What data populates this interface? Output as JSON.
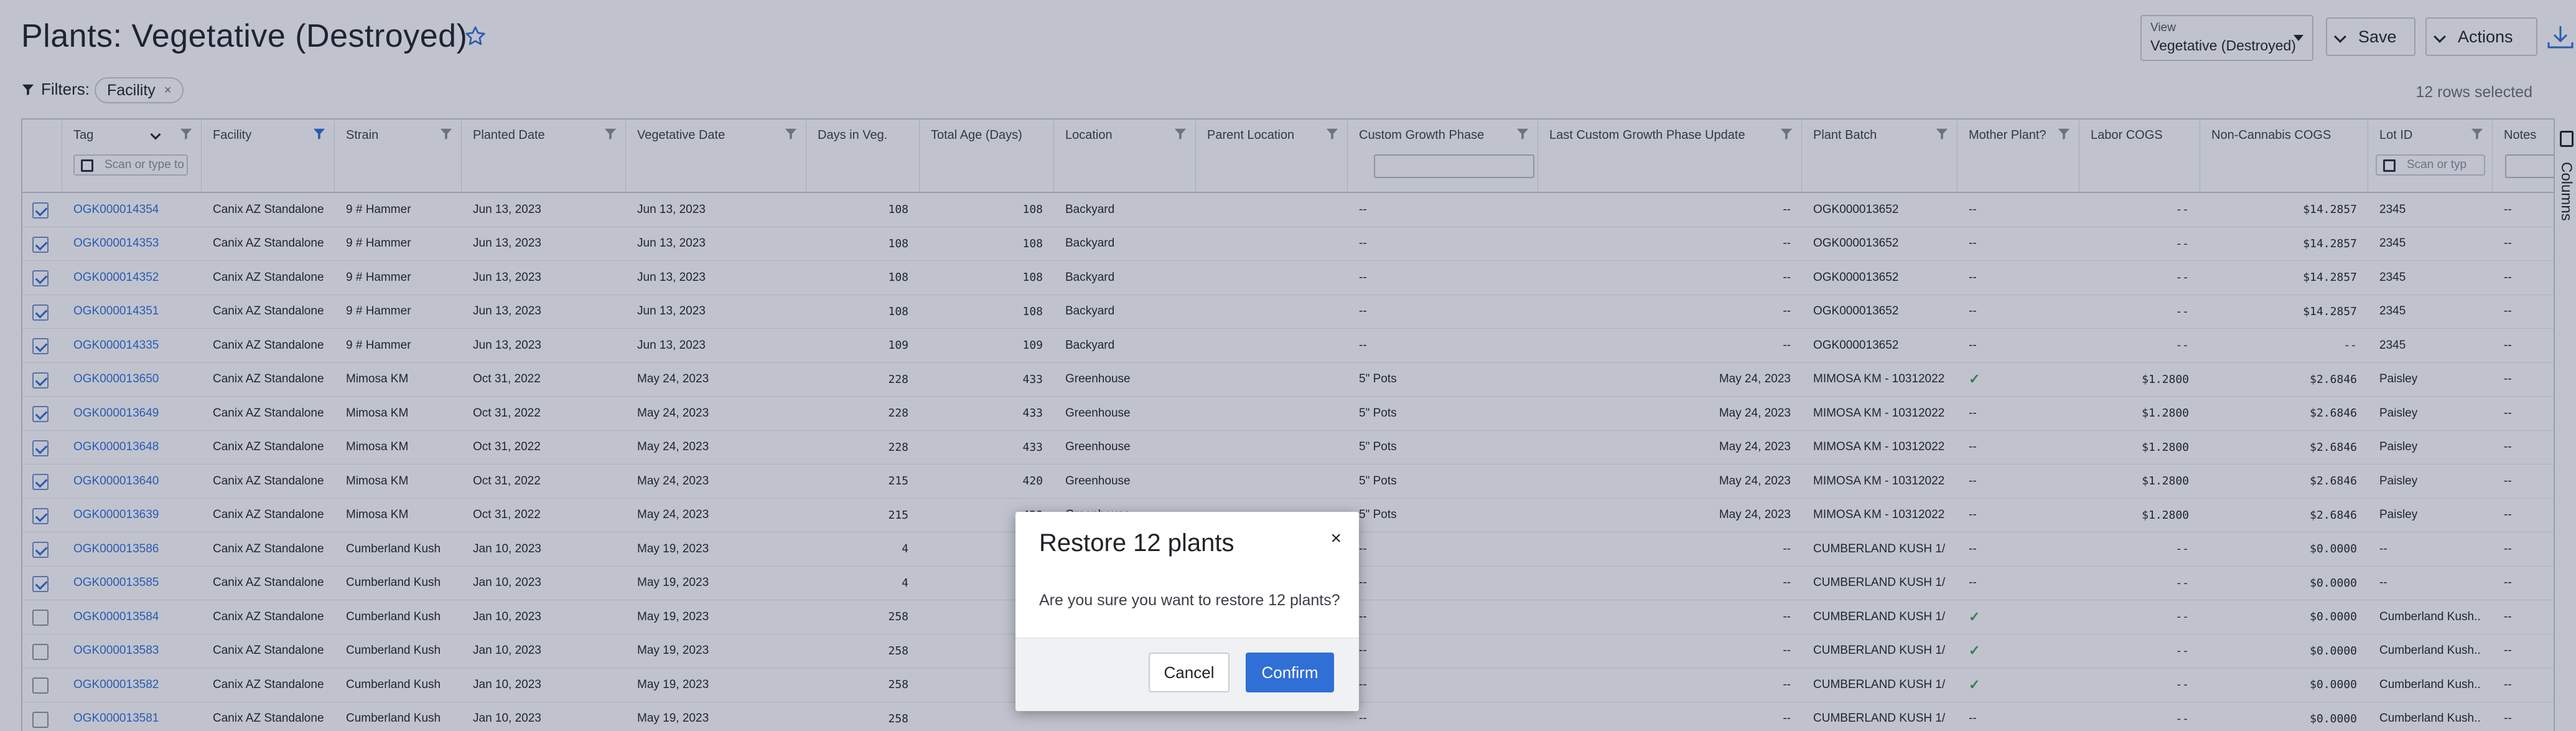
{
  "page": {
    "title": "Plants: Vegetative (Destroyed)"
  },
  "toolbar": {
    "view_label": "View",
    "view_value": "Vegetative (Destroyed)",
    "save_label": "Save",
    "actions_label": "Actions"
  },
  "filters": {
    "label": "Filters:",
    "chips": [
      {
        "label": "Facility"
      }
    ],
    "rows_selected": "12 rows selected"
  },
  "grid": {
    "columns": [
      "Tag",
      "Facility",
      "Strain",
      "Planted Date",
      "Vegetative Date",
      "Days in Veg.",
      "Total Age (Days)",
      "Location",
      "Parent Location",
      "Custom Growth Phase",
      "Last Custom Growth Phase Update",
      "Plant Batch",
      "Mother Plant?",
      "Labor COGS",
      "Non-Cannabis COGS",
      "Lot ID",
      "Notes"
    ],
    "scan_placeholder": "Scan or type to",
    "scan_placeholder_lot": "Scan or typ",
    "side_panel_label": "Columns",
    "rows": [
      {
        "checked": true,
        "tag": "OGK000014354",
        "facility": "Canix AZ Standalone",
        "strain": "9 # Hammer",
        "planted": "Jun 13, 2023",
        "veg_date": "Jun 13, 2023",
        "days_veg": "108",
        "total_age": "108",
        "location": "Backyard",
        "parent_loc": "",
        "cgp": "--",
        "last_cgp": "--",
        "batch": "OGK000013652",
        "mother": "--",
        "labor": "--",
        "noncann": "$14.2857",
        "lot": "2345",
        "notes": "--"
      },
      {
        "checked": true,
        "tag": "OGK000014353",
        "facility": "Canix AZ Standalone",
        "strain": "9 # Hammer",
        "planted": "Jun 13, 2023",
        "veg_date": "Jun 13, 2023",
        "days_veg": "108",
        "total_age": "108",
        "location": "Backyard",
        "parent_loc": "",
        "cgp": "--",
        "last_cgp": "--",
        "batch": "OGK000013652",
        "mother": "--",
        "labor": "--",
        "noncann": "$14.2857",
        "lot": "2345",
        "notes": "--"
      },
      {
        "checked": true,
        "tag": "OGK000014352",
        "facility": "Canix AZ Standalone",
        "strain": "9 # Hammer",
        "planted": "Jun 13, 2023",
        "veg_date": "Jun 13, 2023",
        "days_veg": "108",
        "total_age": "108",
        "location": "Backyard",
        "parent_loc": "",
        "cgp": "--",
        "last_cgp": "--",
        "batch": "OGK000013652",
        "mother": "--",
        "labor": "--",
        "noncann": "$14.2857",
        "lot": "2345",
        "notes": "--"
      },
      {
        "checked": true,
        "tag": "OGK000014351",
        "facility": "Canix AZ Standalone",
        "strain": "9 # Hammer",
        "planted": "Jun 13, 2023",
        "veg_date": "Jun 13, 2023",
        "days_veg": "108",
        "total_age": "108",
        "location": "Backyard",
        "parent_loc": "",
        "cgp": "--",
        "last_cgp": "--",
        "batch": "OGK000013652",
        "mother": "--",
        "labor": "--",
        "noncann": "$14.2857",
        "lot": "2345",
        "notes": "--"
      },
      {
        "checked": true,
        "tag": "OGK000014335",
        "facility": "Canix AZ Standalone",
        "strain": "9 # Hammer",
        "planted": "Jun 13, 2023",
        "veg_date": "Jun 13, 2023",
        "days_veg": "109",
        "total_age": "109",
        "location": "Backyard",
        "parent_loc": "",
        "cgp": "--",
        "last_cgp": "--",
        "batch": "OGK000013652",
        "mother": "--",
        "labor": "--",
        "noncann": "--",
        "lot": "2345",
        "notes": "--"
      },
      {
        "checked": true,
        "tag": "OGK000013650",
        "facility": "Canix AZ Standalone",
        "strain": "Mimosa KM",
        "planted": "Oct 31, 2022",
        "veg_date": "May 24, 2023",
        "days_veg": "228",
        "total_age": "433",
        "location": "Greenhouse",
        "parent_loc": "",
        "cgp": "5\" Pots",
        "last_cgp": "May 24, 2023",
        "batch": "MIMOSA KM - 10312022",
        "mother": "✓",
        "labor": "$1.2800",
        "noncann": "$2.6846",
        "lot": "Paisley",
        "notes": "--"
      },
      {
        "checked": true,
        "tag": "OGK000013649",
        "facility": "Canix AZ Standalone",
        "strain": "Mimosa KM",
        "planted": "Oct 31, 2022",
        "veg_date": "May 24, 2023",
        "days_veg": "228",
        "total_age": "433",
        "location": "Greenhouse",
        "parent_loc": "",
        "cgp": "5\" Pots",
        "last_cgp": "May 24, 2023",
        "batch": "MIMOSA KM - 10312022",
        "mother": "--",
        "labor": "$1.2800",
        "noncann": "$2.6846",
        "lot": "Paisley",
        "notes": "--"
      },
      {
        "checked": true,
        "tag": "OGK000013648",
        "facility": "Canix AZ Standalone",
        "strain": "Mimosa KM",
        "planted": "Oct 31, 2022",
        "veg_date": "May 24, 2023",
        "days_veg": "228",
        "total_age": "433",
        "location": "Greenhouse",
        "parent_loc": "",
        "cgp": "5\" Pots",
        "last_cgp": "May 24, 2023",
        "batch": "MIMOSA KM - 10312022",
        "mother": "--",
        "labor": "$1.2800",
        "noncann": "$2.6846",
        "lot": "Paisley",
        "notes": "--"
      },
      {
        "checked": true,
        "tag": "OGK000013640",
        "facility": "Canix AZ Standalone",
        "strain": "Mimosa KM",
        "planted": "Oct 31, 2022",
        "veg_date": "May 24, 2023",
        "days_veg": "215",
        "total_age": "420",
        "location": "Greenhouse",
        "parent_loc": "",
        "cgp": "5\" Pots",
        "last_cgp": "May 24, 2023",
        "batch": "MIMOSA KM - 10312022",
        "mother": "--",
        "labor": "$1.2800",
        "noncann": "$2.6846",
        "lot": "Paisley",
        "notes": "--"
      },
      {
        "checked": true,
        "tag": "OGK000013639",
        "facility": "Canix AZ Standalone",
        "strain": "Mimosa KM",
        "planted": "Oct 31, 2022",
        "veg_date": "May 24, 2023",
        "days_veg": "215",
        "total_age": "420",
        "location": "Greenhouse",
        "parent_loc": "",
        "cgp": "5\" Pots",
        "last_cgp": "May 24, 2023",
        "batch": "MIMOSA KM - 10312022",
        "mother": "--",
        "labor": "$1.2800",
        "noncann": "$2.6846",
        "lot": "Paisley",
        "notes": "--"
      },
      {
        "checked": true,
        "tag": "OGK000013586",
        "facility": "Canix AZ Standalone",
        "strain": "Cumberland Kush",
        "planted": "Jan 10, 2023",
        "veg_date": "May 19, 2023",
        "days_veg": "4",
        "total_age": "",
        "location": "",
        "parent_loc": "",
        "cgp": "--",
        "last_cgp": "--",
        "batch": "CUMBERLAND KUSH 1/...",
        "mother": "--",
        "labor": "--",
        "noncann": "$0.0000",
        "lot": "--",
        "notes": "--"
      },
      {
        "checked": true,
        "tag": "OGK000013585",
        "facility": "Canix AZ Standalone",
        "strain": "Cumberland Kush",
        "planted": "Jan 10, 2023",
        "veg_date": "May 19, 2023",
        "days_veg": "4",
        "total_age": "",
        "location": "",
        "parent_loc": "",
        "cgp": "--",
        "last_cgp": "--",
        "batch": "CUMBERLAND KUSH 1/...",
        "mother": "--",
        "labor": "--",
        "noncann": "$0.0000",
        "lot": "--",
        "notes": "--"
      },
      {
        "checked": false,
        "tag": "OGK000013584",
        "facility": "Canix AZ Standalone",
        "strain": "Cumberland Kush",
        "planted": "Jan 10, 2023",
        "veg_date": "May 19, 2023",
        "days_veg": "258",
        "total_age": "",
        "location": "",
        "parent_loc": "",
        "cgp": "--",
        "last_cgp": "--",
        "batch": "CUMBERLAND KUSH 1/...",
        "mother": "✓",
        "labor": "--",
        "noncann": "$0.0000",
        "lot": "Cumberland Kush...",
        "notes": "--"
      },
      {
        "checked": false,
        "tag": "OGK000013583",
        "facility": "Canix AZ Standalone",
        "strain": "Cumberland Kush",
        "planted": "Jan 10, 2023",
        "veg_date": "May 19, 2023",
        "days_veg": "258",
        "total_age": "",
        "location": "",
        "parent_loc": "",
        "cgp": "--",
        "last_cgp": "--",
        "batch": "CUMBERLAND KUSH 1/...",
        "mother": "✓",
        "labor": "--",
        "noncann": "$0.0000",
        "lot": "Cumberland Kush...",
        "notes": "--"
      },
      {
        "checked": false,
        "tag": "OGK000013582",
        "facility": "Canix AZ Standalone",
        "strain": "Cumberland Kush",
        "planted": "Jan 10, 2023",
        "veg_date": "May 19, 2023",
        "days_veg": "258",
        "total_age": "",
        "location": "",
        "parent_loc": "",
        "cgp": "--",
        "last_cgp": "--",
        "batch": "CUMBERLAND KUSH 1/...",
        "mother": "✓",
        "labor": "--",
        "noncann": "$0.0000",
        "lot": "Cumberland Kush...",
        "notes": "--"
      },
      {
        "checked": false,
        "tag": "OGK000013581",
        "facility": "Canix AZ Standalone",
        "strain": "Cumberland Kush",
        "planted": "Jan 10, 2023",
        "veg_date": "May 19, 2023",
        "days_veg": "258",
        "total_age": "",
        "location": "",
        "parent_loc": "",
        "cgp": "--",
        "last_cgp": "--",
        "batch": "CUMBERLAND KUSH 1/...",
        "mother": "--",
        "labor": "--",
        "noncann": "$0.0000",
        "lot": "Cumberland Kush...",
        "notes": "--"
      }
    ]
  },
  "modal": {
    "title": "Restore 12 plants",
    "body": "Are you sure you want to restore 12 plants?",
    "cancel_label": "Cancel",
    "confirm_label": "Confirm",
    "close_glyph": "×"
  },
  "colors": {
    "accent": "#2f6fd6",
    "check": "#3ea34a",
    "overlay": "rgba(30,40,80,0.28)"
  },
  "icons": {
    "favorite": "star-icon",
    "filter": "funnel-icon",
    "download": "download-icon",
    "columns": "columns-icon",
    "scan": "barcode-icon"
  }
}
